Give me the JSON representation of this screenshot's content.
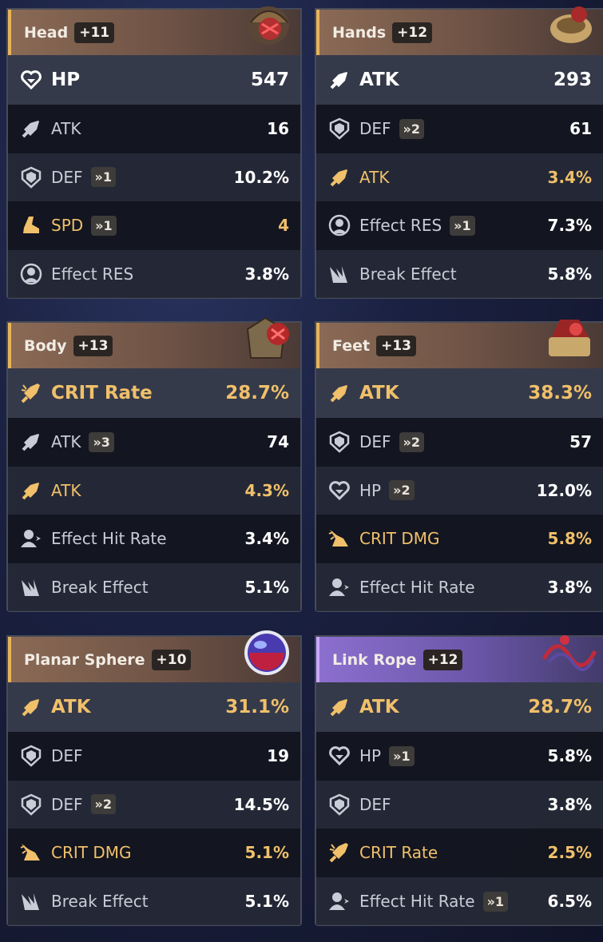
{
  "cards": [
    {
      "slot": "Head",
      "level": "+11",
      "art": "helmet",
      "main": {
        "stat": "HP",
        "value": "547",
        "icon": "heart-icon"
      },
      "subs": [
        {
          "stat": "ATK",
          "value": "16",
          "icon": "sword-icon",
          "roll": "",
          "gold": false
        },
        {
          "stat": "DEF",
          "value": "10.2%",
          "icon": "shield-icon",
          "roll": "»1",
          "gold": false
        },
        {
          "stat": "SPD",
          "value": "4",
          "icon": "boot-icon",
          "roll": "»1",
          "gold": true
        },
        {
          "stat": "Effect RES",
          "value": "3.8%",
          "icon": "resist-icon",
          "roll": "",
          "gold": false
        }
      ]
    },
    {
      "slot": "Hands",
      "level": "+12",
      "art": "gloves",
      "main": {
        "stat": "ATK",
        "value": "293",
        "icon": "sword-icon"
      },
      "subs": [
        {
          "stat": "DEF",
          "value": "61",
          "icon": "shield-icon",
          "roll": "»2",
          "gold": false
        },
        {
          "stat": "ATK",
          "value": "3.4%",
          "icon": "sword-icon",
          "roll": "",
          "gold": true
        },
        {
          "stat": "Effect RES",
          "value": "7.3%",
          "icon": "resist-icon",
          "roll": "»1",
          "gold": false
        },
        {
          "stat": "Break Effect",
          "value": "5.8%",
          "icon": "break-icon",
          "roll": "",
          "gold": false
        }
      ]
    },
    {
      "slot": "Body",
      "level": "+13",
      "art": "armor",
      "main": {
        "stat": "CRIT Rate",
        "value": "28.7%",
        "icon": "crit-rate-icon",
        "gold": true
      },
      "subs": [
        {
          "stat": "ATK",
          "value": "74",
          "icon": "sword-icon",
          "roll": "»3",
          "gold": false
        },
        {
          "stat": "ATK",
          "value": "4.3%",
          "icon": "sword-icon",
          "roll": "",
          "gold": true
        },
        {
          "stat": "Effect Hit Rate",
          "value": "3.4%",
          "icon": "hit-rate-icon",
          "roll": "",
          "gold": false
        },
        {
          "stat": "Break Effect",
          "value": "5.1%",
          "icon": "break-icon",
          "roll": "",
          "gold": false
        }
      ]
    },
    {
      "slot": "Feet",
      "level": "+13",
      "art": "boots",
      "main": {
        "stat": "ATK",
        "value": "38.3%",
        "icon": "sword-icon",
        "gold": true
      },
      "subs": [
        {
          "stat": "DEF",
          "value": "57",
          "icon": "shield-icon",
          "roll": "»2",
          "gold": false
        },
        {
          "stat": "HP",
          "value": "12.0%",
          "icon": "heart-icon",
          "roll": "»2",
          "gold": false
        },
        {
          "stat": "CRIT DMG",
          "value": "5.8%",
          "icon": "crit-dmg-icon",
          "roll": "",
          "gold": true
        },
        {
          "stat": "Effect Hit Rate",
          "value": "3.8%",
          "icon": "hit-rate-icon",
          "roll": "",
          "gold": false
        }
      ]
    },
    {
      "slot": "Planar Sphere",
      "level": "+10",
      "art": "sphere",
      "main": {
        "stat": "ATK",
        "value": "31.1%",
        "icon": "sword-icon",
        "gold": true
      },
      "subs": [
        {
          "stat": "DEF",
          "value": "19",
          "icon": "shield-icon",
          "roll": "",
          "gold": false
        },
        {
          "stat": "DEF",
          "value": "14.5%",
          "icon": "shield-icon",
          "roll": "»2",
          "gold": false
        },
        {
          "stat": "CRIT DMG",
          "value": "5.1%",
          "icon": "crit-dmg-icon",
          "roll": "",
          "gold": true
        },
        {
          "stat": "Break Effect",
          "value": "5.1%",
          "icon": "break-icon",
          "roll": "",
          "gold": false
        }
      ]
    },
    {
      "slot": "Link Rope",
      "level": "+12",
      "art": "rope",
      "main": {
        "stat": "ATK",
        "value": "28.7%",
        "icon": "sword-icon",
        "gold": true
      },
      "subs": [
        {
          "stat": "HP",
          "value": "5.8%",
          "icon": "heart-icon",
          "roll": "»1",
          "gold": false
        },
        {
          "stat": "DEF",
          "value": "3.8%",
          "icon": "shield-icon",
          "roll": "",
          "gold": false
        },
        {
          "stat": "CRIT Rate",
          "value": "2.5%",
          "icon": "crit-rate-icon",
          "roll": "",
          "gold": true
        },
        {
          "stat": "Effect Hit Rate",
          "value": "6.5%",
          "icon": "hit-rate-icon",
          "roll": "»1",
          "gold": false
        }
      ]
    }
  ],
  "colors": {
    "gold": "#f0c06a",
    "white": "#ffffff",
    "muted": "#c9ccd6"
  }
}
